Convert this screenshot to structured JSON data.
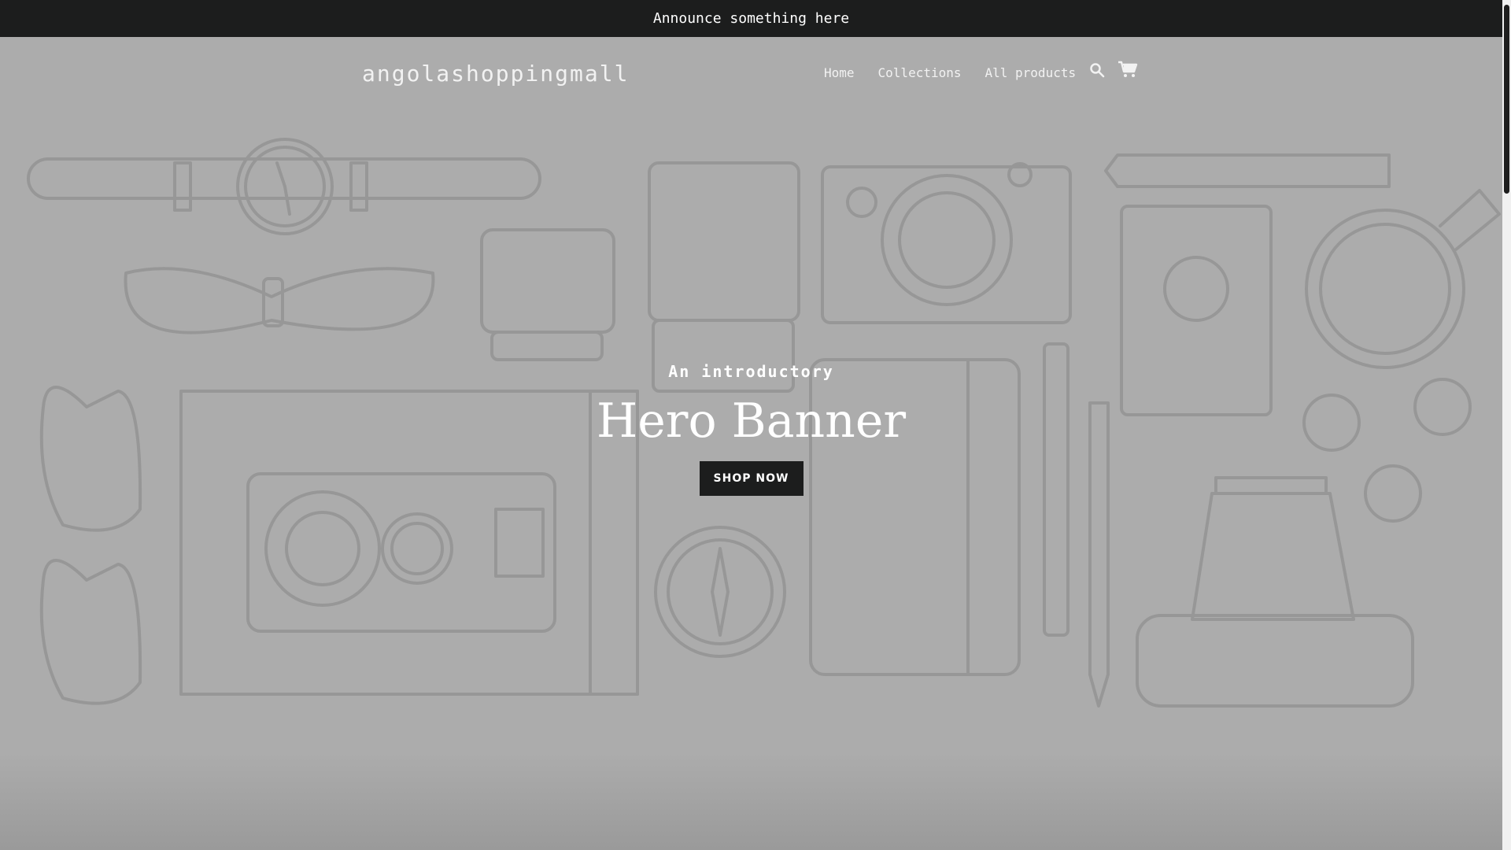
{
  "announcement": {
    "text": "Announce something here"
  },
  "header": {
    "logo": "angolashoppingmall",
    "nav": [
      {
        "label": "Home"
      },
      {
        "label": "Collections"
      },
      {
        "label": "All products"
      }
    ],
    "icons": {
      "search": "search-icon",
      "cart": "cart-icon"
    }
  },
  "hero": {
    "subtitle": "An introductory",
    "title": "Hero Banner",
    "button": "SHOP NOW"
  },
  "colors": {
    "announcement_bg": "#1c1d1d",
    "hero_overlay": "#acacac",
    "button_bg": "#1c1d1d",
    "text": "#ffffff"
  }
}
